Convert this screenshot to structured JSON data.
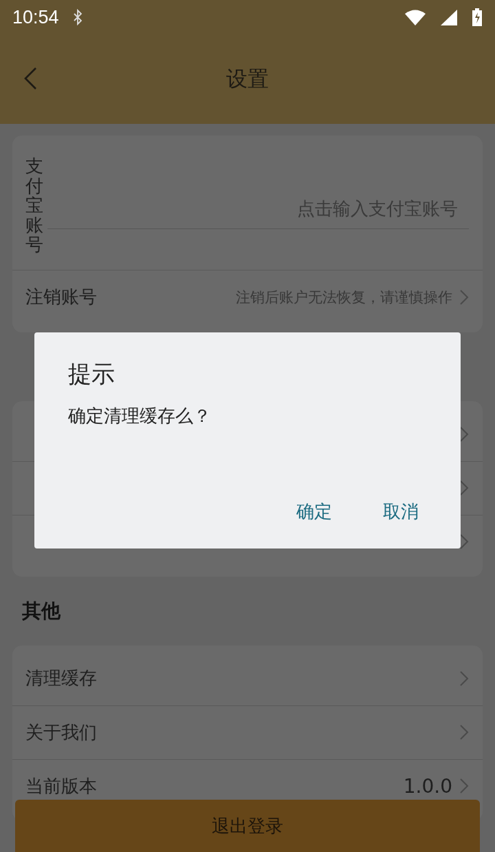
{
  "status_bar": {
    "time": "10:54"
  },
  "header": {
    "title": "设置"
  },
  "account_card": {
    "alipay": {
      "label": "支付宝账号",
      "placeholder": "点击输入支付宝账号"
    },
    "cancel": {
      "label": "注销账号",
      "hint": "注销后账户无法恢复，请谨慎操作"
    }
  },
  "sections": [
    {
      "title": "其他",
      "rows": [
        {
          "label": "清理缓存"
        },
        {
          "label": "关于我们"
        },
        {
          "label": "当前版本",
          "value": "1.0.0"
        }
      ]
    }
  ],
  "logout_button": "退出登录",
  "dialog": {
    "title": "提示",
    "message": "确定清理缓存么？",
    "buttons": [
      "确定",
      "取消"
    ]
  }
}
